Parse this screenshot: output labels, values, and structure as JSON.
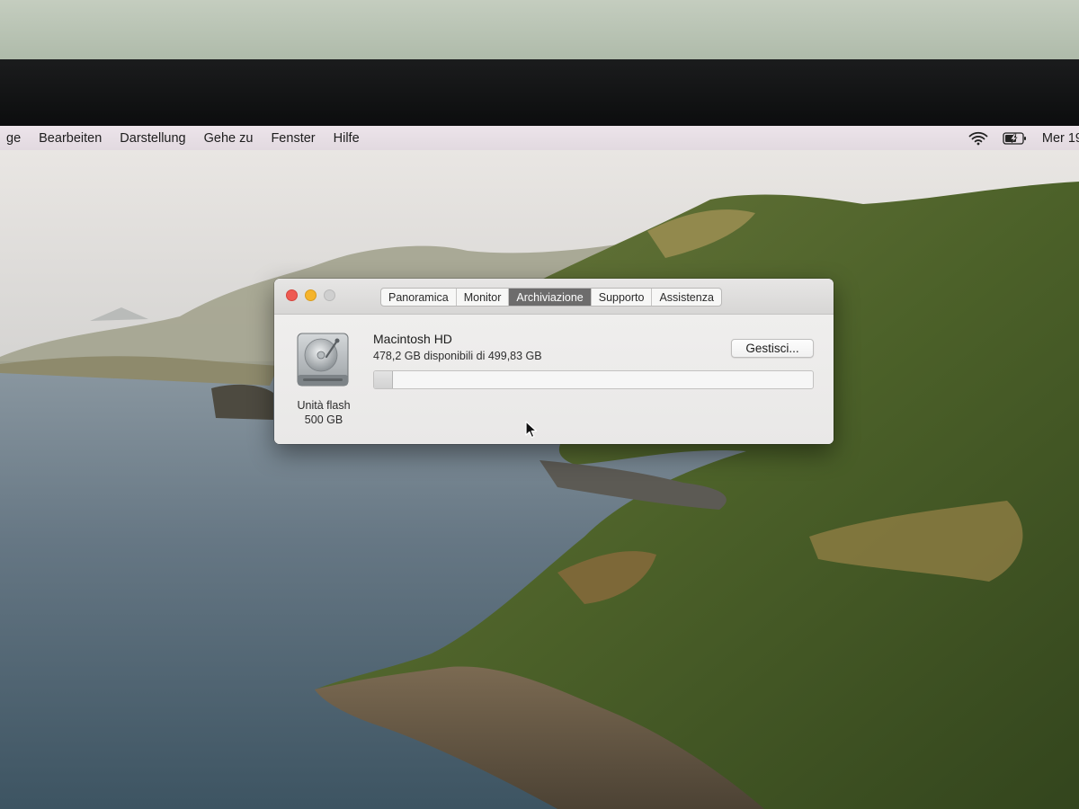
{
  "menubar": {
    "items": [
      "ge",
      "Bearbeiten",
      "Darstellung",
      "Gehe zu",
      "Fenster",
      "Hilfe"
    ],
    "status_icons": [
      "wifi-icon",
      "battery-charging-icon"
    ],
    "clock": "Mer 19"
  },
  "window": {
    "tabs": [
      {
        "label": "Panoramica",
        "active": false
      },
      {
        "label": "Monitor",
        "active": false
      },
      {
        "label": "Archiviazione",
        "active": true
      },
      {
        "label": "Supporto",
        "active": false
      },
      {
        "label": "Assistenza",
        "active": false
      }
    ],
    "disk": {
      "icon": "hard-drive-icon",
      "type_label": "Unità flash",
      "size_label": "500 GB"
    },
    "volume": {
      "name": "Macintosh HD",
      "available_text": "478,2 GB disponibili di 499,83 GB",
      "used_fraction": 0.043
    },
    "manage_button": "Gestisci..."
  },
  "colors": {
    "close": "#ee5a52",
    "minimize": "#f5b42c",
    "zoom_inactive": "#cfcfcf",
    "active_tab": "#6d6c6c"
  }
}
